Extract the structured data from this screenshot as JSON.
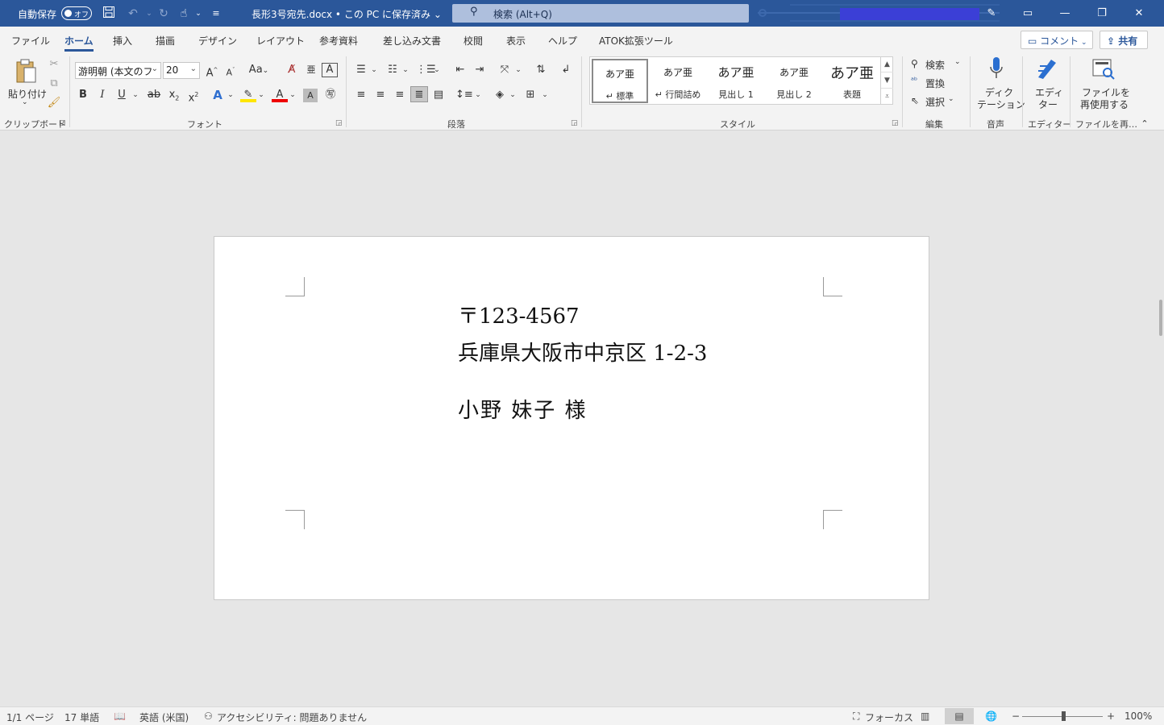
{
  "titlebar": {
    "autosave_label": "自動保存",
    "autosave_state": "オフ",
    "doc_title": "長形3号宛先.docx • この PC に保存済み ⌄",
    "search_placeholder": "検索 (Alt+Q)",
    "icons": [
      "save-icon",
      "undo-icon",
      "redo-icon",
      "touch-mode-icon",
      "customize-qat-icon",
      "pen-icon",
      "ribbon-display-icon",
      "minimize-icon",
      "restore-icon",
      "close-icon"
    ],
    "accent_color": "#2b579a"
  },
  "tabs": [
    {
      "label": "ファイル"
    },
    {
      "label": "ホーム",
      "active": true
    },
    {
      "label": "挿入"
    },
    {
      "label": "描画"
    },
    {
      "label": "デザイン"
    },
    {
      "label": "レイアウト"
    },
    {
      "label": "参考資料"
    },
    {
      "label": "差し込み文書"
    },
    {
      "label": "校閲"
    },
    {
      "label": "表示"
    },
    {
      "label": "ヘルプ"
    },
    {
      "label": "ATOK拡張ツール"
    }
  ],
  "actions": {
    "comment": "コメント",
    "share": "共有"
  },
  "clipboard": {
    "paste": "貼り付け",
    "group": "クリップボード"
  },
  "font": {
    "font_name": "游明朝 (本文のフ",
    "font_size": "20",
    "case": "Aa",
    "group": "フォント"
  },
  "paragraph": {
    "group": "段落"
  },
  "styles": {
    "items": [
      {
        "preview": "あア亜",
        "name": "↵ 標準"
      },
      {
        "preview": "あア亜",
        "name": "↵ 行間詰め"
      },
      {
        "preview": "あア亜",
        "name": "見出し 1"
      },
      {
        "preview": "あア亜",
        "name": "見出し 2"
      },
      {
        "preview": "あア亜",
        "name": "表題"
      }
    ],
    "group": "スタイル"
  },
  "editing": {
    "find": "検索",
    "replace": "置換",
    "select": "選択",
    "group": "編集"
  },
  "voice": {
    "dictate_1": "ディク",
    "dictate_2": "テーション",
    "group": "音声"
  },
  "editor": {
    "label_1": "エディ",
    "label_2": "ター",
    "group": "エディター"
  },
  "reuse": {
    "label_1": "ファイルを",
    "label_2": "再使用する",
    "group": "ファイルを再…"
  },
  "document": {
    "postal": "〒123-4567",
    "address": "兵庫県大阪市中京区 1-2-3",
    "recipient": "小野 妹子 様"
  },
  "statusbar": {
    "page": "1/1 ページ",
    "words": "17 単語",
    "language": "英語 (米国)",
    "accessibility": "アクセシビリティ: 問題ありません",
    "focus": "フォーカス",
    "zoom_percent": "100%"
  }
}
